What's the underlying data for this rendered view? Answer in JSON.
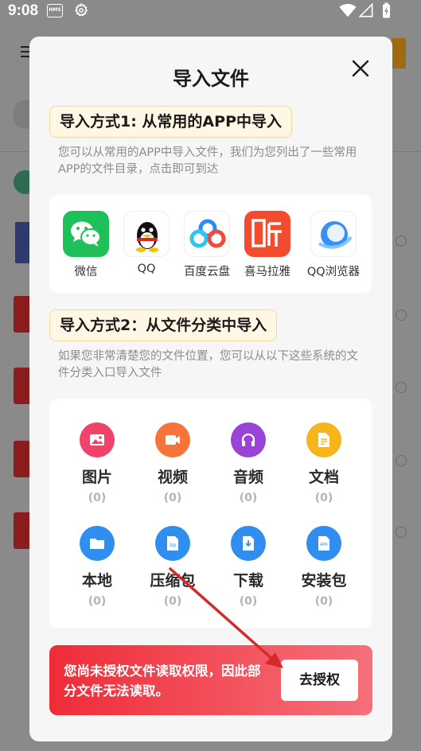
{
  "status_bar": {
    "time": "9:08",
    "hms_badge": "HMS"
  },
  "dialog": {
    "title": "导入文件",
    "section1": {
      "tag": "导入方式1: 从常用的APP中导入",
      "description": "您可以从常用的APP中导入文件，我们为您列出了一些常用APP的文件目录，点击即可到达",
      "apps": [
        {
          "label": "微信",
          "icon": "wechat-icon",
          "color": "#1fc05a"
        },
        {
          "label": "QQ",
          "icon": "qq-icon",
          "color": "#111111"
        },
        {
          "label": "百度云盘",
          "icon": "baidu-netdisk-icon",
          "color": "#2a8cf0"
        },
        {
          "label": "喜马拉雅",
          "icon": "ximalaya-icon",
          "color": "#f24b2d"
        },
        {
          "label": "QQ浏览器",
          "icon": "qq-browser-icon",
          "color": "#3a8ff5"
        }
      ]
    },
    "section2": {
      "tag": "导入方式2：从文件分类中导入",
      "description": "如果您非常清楚您的文件位置，您可以从以下这些系统的文件分类入口导入文件",
      "categories": [
        {
          "label": "图片",
          "count": "(0)",
          "icon": "image-icon",
          "color": "#f0426a"
        },
        {
          "label": "视频",
          "count": "(0)",
          "icon": "video-icon",
          "color": "#f5743a"
        },
        {
          "label": "音频",
          "count": "(0)",
          "icon": "headphones-icon",
          "color": "#9b43d6"
        },
        {
          "label": "文档",
          "count": "(0)",
          "icon": "document-icon",
          "color": "#f7b51c"
        },
        {
          "label": "本地",
          "count": "(0)",
          "icon": "folder-icon",
          "color": "#2f8ef0"
        },
        {
          "label": "压缩包",
          "count": "(0)",
          "icon": "zip-icon",
          "color": "#2f8ef0"
        },
        {
          "label": "下载",
          "count": "(0)",
          "icon": "download-icon",
          "color": "#2f8ef0"
        },
        {
          "label": "安装包",
          "count": "(0)",
          "icon": "apk-icon",
          "color": "#2f8ef0"
        }
      ]
    },
    "warning": {
      "message": "您尚未授权文件读取权限，因此部分文件无法读取。",
      "button_label": "去授权"
    }
  },
  "colors": {
    "accent_red": "#ef2c38",
    "annotation_arrow": "#d42a2a",
    "tag_background": "#fff7e3"
  }
}
